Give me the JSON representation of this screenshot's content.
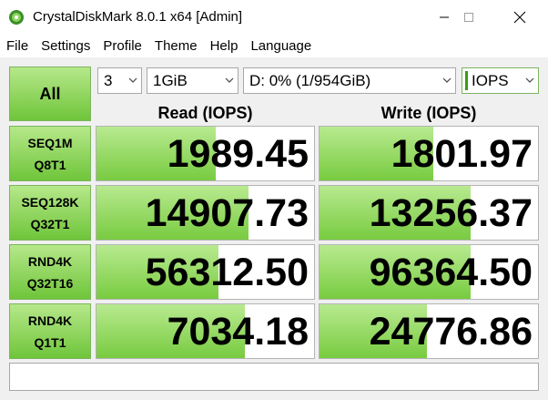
{
  "window": {
    "title": "CrystalDiskMark 8.0.1 x64 [Admin]"
  },
  "menu": [
    "File",
    "Settings",
    "Profile",
    "Theme",
    "Help",
    "Language"
  ],
  "controls": {
    "all_label": "All",
    "count": "3",
    "size": "1GiB",
    "drive": "D: 0% (1/954GiB)",
    "unit": "IOPS"
  },
  "headers": {
    "read": "Read (IOPS)",
    "write": "Write (IOPS)"
  },
  "tests": [
    {
      "line1": "SEQ1M",
      "line2": "Q8T1",
      "read": "1989.45",
      "write": "1801.97",
      "read_fill": 0.55,
      "write_fill": 0.52
    },
    {
      "line1": "SEQ128K",
      "line2": "Q32T1",
      "read": "14907.73",
      "write": "13256.37",
      "read_fill": 0.7,
      "write_fill": 0.69
    },
    {
      "line1": "RND4K",
      "line2": "Q32T16",
      "read": "56312.50",
      "write": "96364.50",
      "read_fill": 0.56,
      "write_fill": 0.69
    },
    {
      "line1": "RND4K",
      "line2": "Q1T1",
      "read": "7034.18",
      "write": "24776.86",
      "read_fill": 0.68,
      "write_fill": 0.49
    }
  ],
  "status": "",
  "colors": {
    "accent_green": "#6fc53a",
    "accent_light": "#b6e88a"
  }
}
